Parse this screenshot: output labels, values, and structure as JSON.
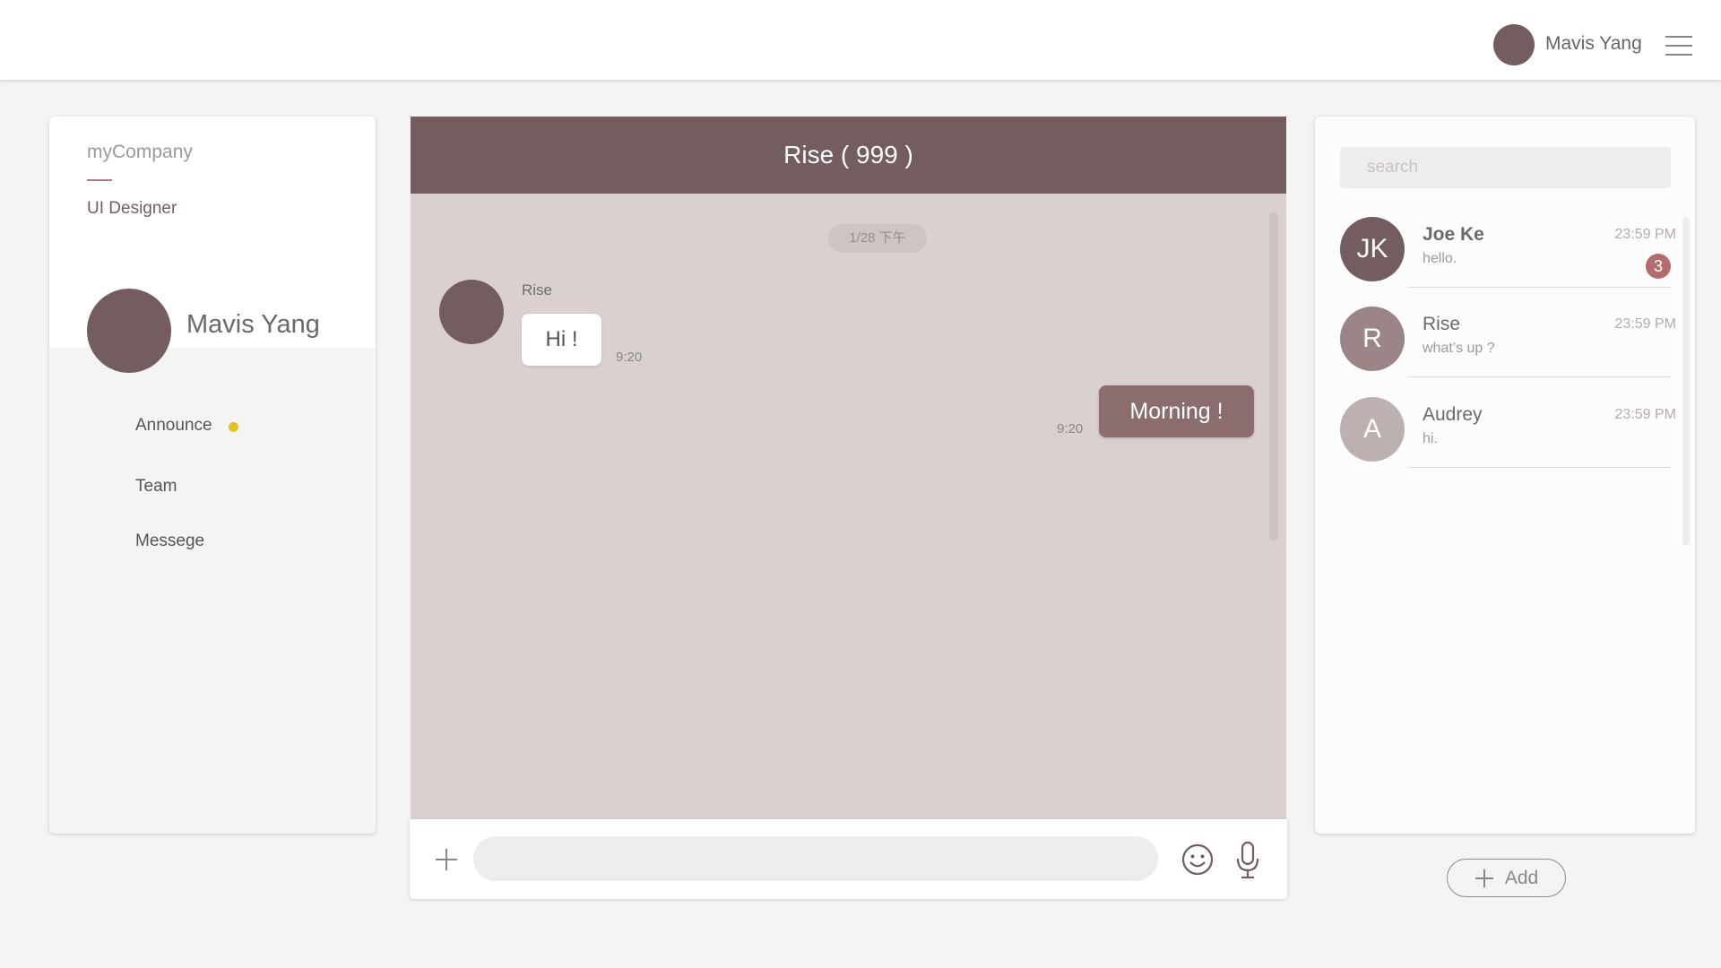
{
  "header": {
    "user_name": "Mavis Yang",
    "avatar": "avatar",
    "menu_icon": "hamburger-menu-icon"
  },
  "left_panel": {
    "company": "myCompany",
    "role": "UI Designer",
    "profile_name": "Mavis Yang",
    "nav": [
      {
        "label": "Announce",
        "has_notification_dot": true
      },
      {
        "label": "Team"
      },
      {
        "label": "Messege"
      }
    ]
  },
  "chat": {
    "title": "Rise ( 999 )",
    "date_chip": "1/28 下午",
    "messages": [
      {
        "direction": "incoming",
        "sender": "Rise",
        "text": "Hi !",
        "time": "9:20"
      },
      {
        "direction": "outgoing",
        "text": "Morning !",
        "time": "9:20"
      }
    ],
    "input_value": "",
    "icons": {
      "attach": "plus-icon",
      "emoji": "smiley-icon",
      "voice": "microphone-icon"
    }
  },
  "contacts_panel": {
    "search_placeholder": "search",
    "contacts": [
      {
        "initials": "JK",
        "name": "Joe Ke",
        "message": "hello.",
        "time": "23:59 PM",
        "unread": "3",
        "avatar_color": "#735d5f"
      },
      {
        "initials": "R",
        "name": "Rise",
        "message": "what’s up ?",
        "time": "23:59 PM",
        "avatar_color": "#9b8587"
      },
      {
        "initials": "A",
        "name": "Audrey",
        "message": "hi.",
        "time": "23:59 PM",
        "avatar_color": "#bcb0b1"
      }
    ],
    "add_label": "Add"
  },
  "colors": {
    "brand": "#735d5f",
    "chat_background": "#dbd0d0",
    "outgoing_bubble": "#8b6d70",
    "notification_dot": "#e3c21c",
    "badge": "#b56b6d"
  }
}
